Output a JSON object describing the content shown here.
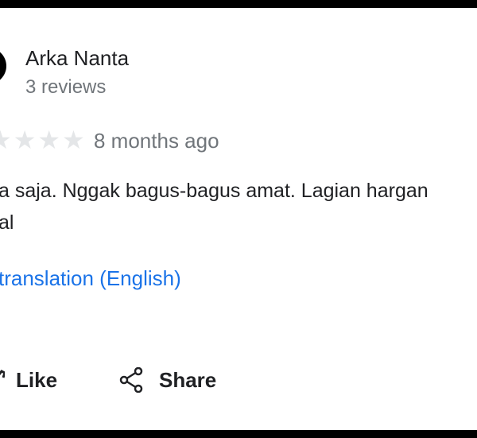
{
  "review": {
    "author_name": "Arka Nanta",
    "author_reviews": "3 reviews",
    "rating": 0,
    "rating_max": 5,
    "date": "8 months ago",
    "text_lines": [
      "a saja. Nggak bagus-bagus amat. Lagian hargan",
      "al"
    ],
    "translation_link": "translation (English)"
  },
  "actions": {
    "like_label": "Like",
    "share_label": "Share"
  },
  "icons": {
    "like": "thumbs-up-icon",
    "share": "share-icon",
    "star": "star-icon",
    "avatar": "avatar"
  },
  "colors": {
    "text": "#202124",
    "secondary": "#70757a",
    "link": "#1a73e8",
    "star_empty": "#e4e6e8",
    "frame": "#000000"
  }
}
